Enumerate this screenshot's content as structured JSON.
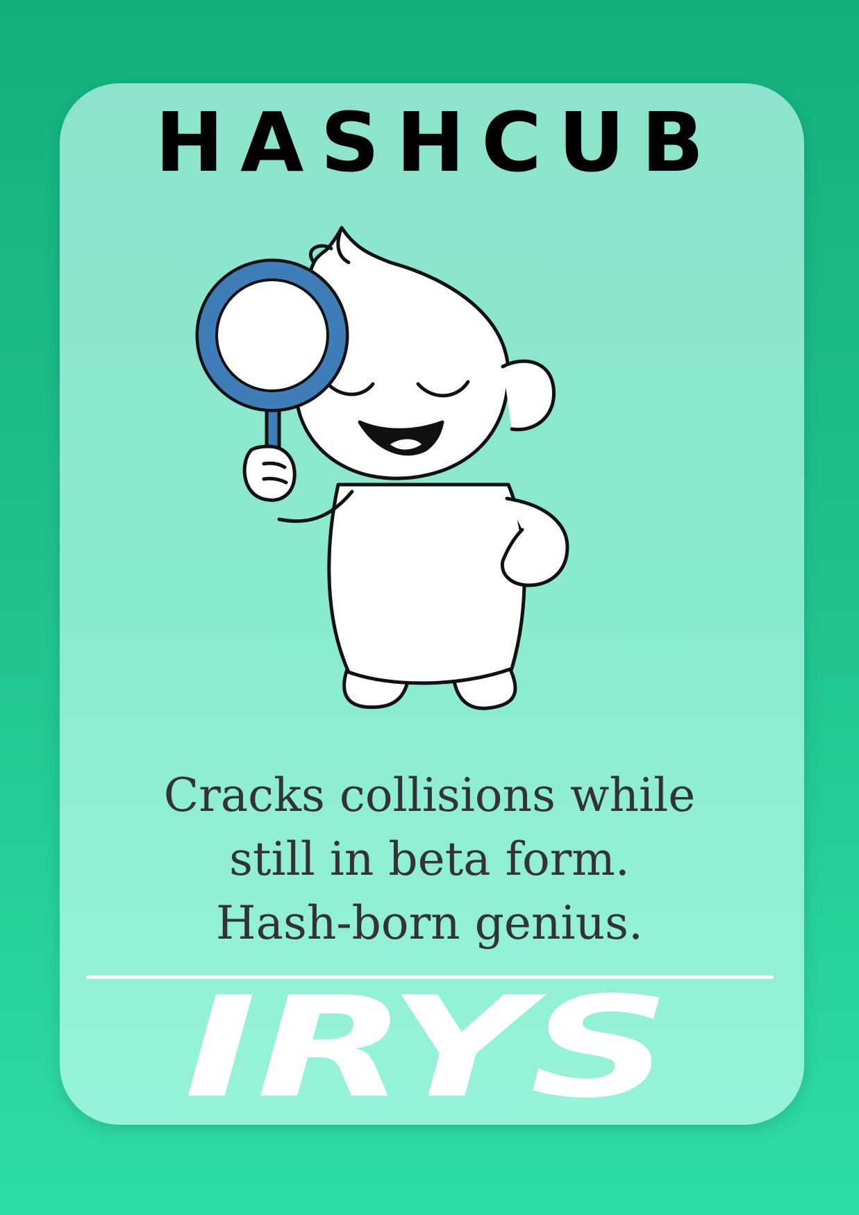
{
  "card": {
    "title": "HASHCUB",
    "blurb": {
      "line1": "Cracks collisions while",
      "line2": "still in beta form.",
      "line3": "Hash-born genius."
    },
    "brand": "IRYS"
  },
  "mascot": {
    "icon": "mascot-with-magnifying-glass-icon",
    "prop": "magnifying-glass-icon"
  },
  "colors": {
    "background": "#13b07d",
    "card": "#8de3cd",
    "title": "#000000",
    "text": "#333333",
    "magnifier_ring": "#3e7db7",
    "logo": "#ffffff"
  }
}
